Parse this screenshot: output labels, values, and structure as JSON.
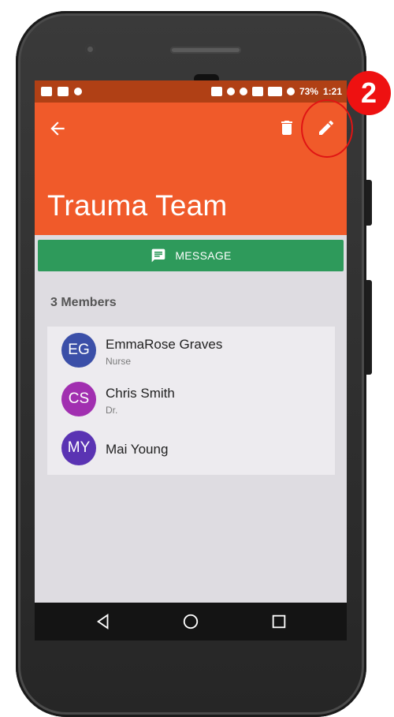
{
  "statusbar": {
    "battery": "73%",
    "time": "1:21"
  },
  "appbar": {
    "title": "Trauma Team"
  },
  "message_button": {
    "label": "MESSAGE"
  },
  "members": {
    "count_label": "3 Members",
    "items": [
      {
        "initials": "EG",
        "name": "EmmaRose Graves",
        "role": "Nurse",
        "color": "#3b4fa8"
      },
      {
        "initials": "CS",
        "name": "Chris Smith",
        "role": "Dr.",
        "color": "#a12fb0"
      },
      {
        "initials": "MY",
        "name": "Mai Young",
        "role": "",
        "color": "#5a33b3"
      }
    ]
  },
  "annotation": {
    "step_number": "2",
    "color": "#ee1111"
  },
  "colors": {
    "appbar": "#f05a2a",
    "statusbar": "#b04015",
    "message_button": "#2e9a5b"
  },
  "icons": {
    "back": "arrow-left-icon",
    "delete": "trash-icon",
    "edit": "pencil-icon",
    "message": "chat-icon",
    "nav_back": "triangle-back-icon",
    "nav_home": "circle-home-icon",
    "nav_recents": "square-recents-icon"
  }
}
